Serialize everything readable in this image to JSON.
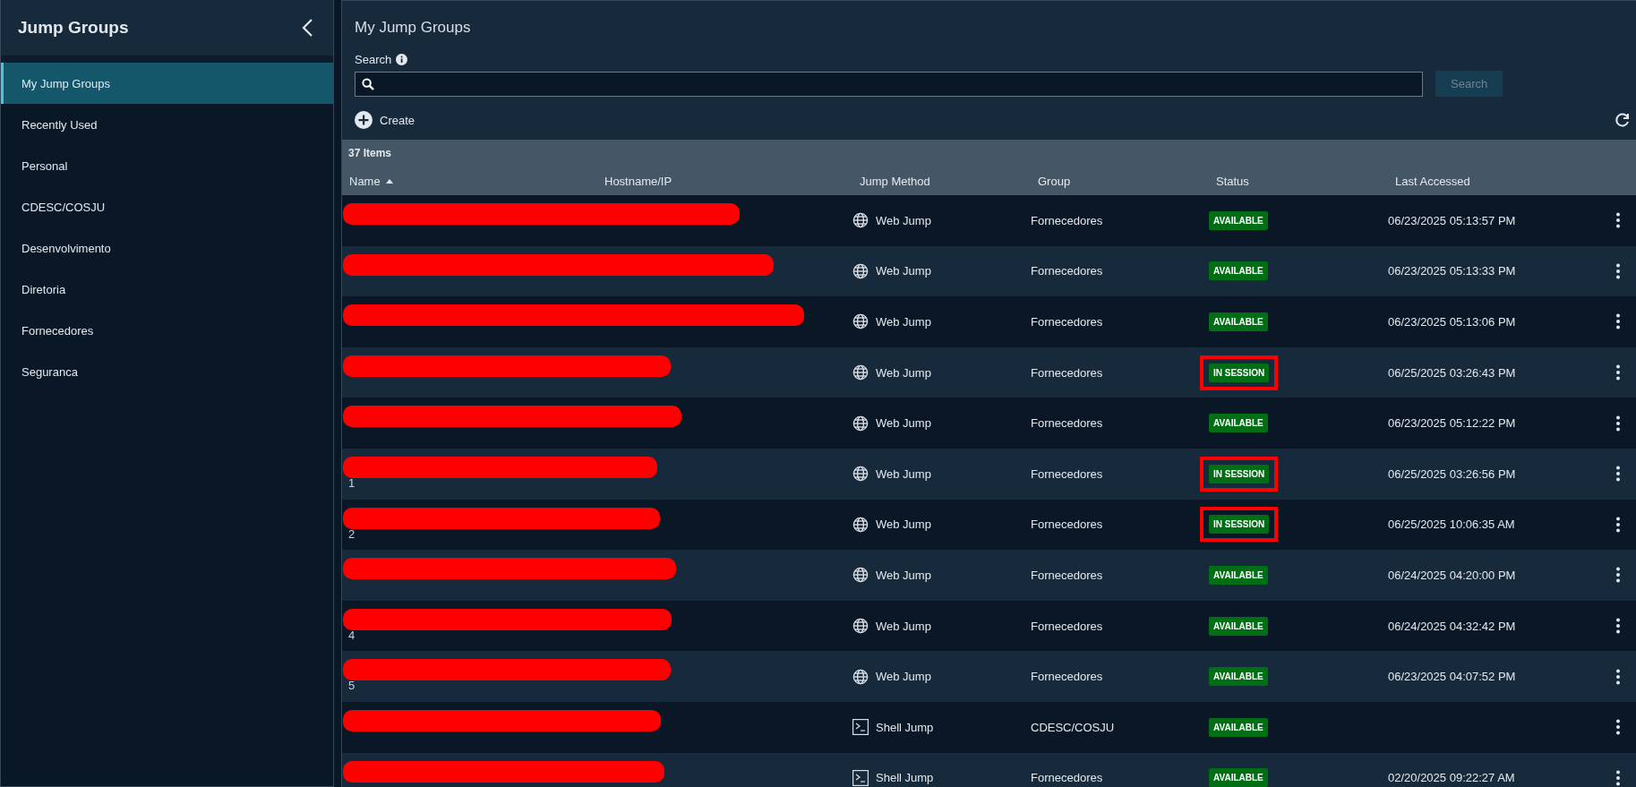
{
  "sidebar": {
    "title": "Jump Groups",
    "items": [
      {
        "label": "My Jump Groups",
        "selected": true
      },
      {
        "label": "Recently Used",
        "selected": false
      },
      {
        "label": "Personal",
        "selected": false
      },
      {
        "label": "CDESC/COSJU",
        "selected": false
      },
      {
        "label": "Desenvolvimento",
        "selected": false
      },
      {
        "label": "Diretoria",
        "selected": false
      },
      {
        "label": "Fornecedores",
        "selected": false
      },
      {
        "label": "Seguranca",
        "selected": false
      }
    ]
  },
  "main": {
    "title": "My Jump Groups",
    "search": {
      "label": "Search",
      "button": "Search"
    },
    "create": "Create"
  },
  "table": {
    "count": "37 Items",
    "columns": [
      {
        "label": "Name",
        "sorted": true
      },
      {
        "label": "Hostname/IP",
        "sorted": false
      },
      {
        "label": "Jump Method",
        "sorted": false
      },
      {
        "label": "Group",
        "sorted": false
      },
      {
        "label": "Status",
        "sorted": false
      },
      {
        "label": "Last Accessed",
        "sorted": false
      }
    ],
    "rows": [
      {
        "redacted": true,
        "method": "Web Jump",
        "kind": "web",
        "group": "Fornecedores",
        "status": "AVAILABLE",
        "highlighted": false,
        "last_accessed": "06/23/2025 05:13:57 PM"
      },
      {
        "redacted": true,
        "method": "Web Jump",
        "kind": "web",
        "group": "Fornecedores",
        "status": "AVAILABLE",
        "highlighted": false,
        "last_accessed": "06/23/2025 05:13:33 PM"
      },
      {
        "redacted": true,
        "method": "Web Jump",
        "kind": "web",
        "group": "Fornecedores",
        "status": "AVAILABLE",
        "highlighted": false,
        "last_accessed": "06/23/2025 05:13:06 PM"
      },
      {
        "redacted": true,
        "method": "Web Jump",
        "kind": "web",
        "group": "Fornecedores",
        "status": "IN SESSION",
        "highlighted": true,
        "last_accessed": "06/25/2025 03:26:43 PM"
      },
      {
        "redacted": true,
        "method": "Web Jump",
        "kind": "web",
        "group": "Fornecedores",
        "status": "AVAILABLE",
        "highlighted": false,
        "last_accessed": "06/23/2025 05:12:22 PM"
      },
      {
        "redacted": true,
        "name": "1",
        "method": "Web Jump",
        "kind": "web",
        "group": "Fornecedores",
        "status": "IN SESSION",
        "highlighted": true,
        "last_accessed": "06/25/2025 03:26:56 PM"
      },
      {
        "redacted": true,
        "name": "2",
        "method": "Web Jump",
        "kind": "web",
        "group": "Fornecedores",
        "status": "IN SESSION",
        "highlighted": true,
        "last_accessed": "06/25/2025 10:06:35 AM"
      },
      {
        "redacted": true,
        "method": "Web Jump",
        "kind": "web",
        "group": "Fornecedores",
        "status": "AVAILABLE",
        "highlighted": false,
        "last_accessed": "06/24/2025 04:20:00 PM"
      },
      {
        "redacted": true,
        "name": "4",
        "method": "Web Jump",
        "kind": "web",
        "group": "Fornecedores",
        "status": "AVAILABLE",
        "highlighted": false,
        "last_accessed": "06/24/2025 04:32:42 PM"
      },
      {
        "redacted": true,
        "name": "5",
        "method": "Web Jump",
        "kind": "web",
        "group": "Fornecedores",
        "status": "AVAILABLE",
        "highlighted": false,
        "last_accessed": "06/23/2025 04:07:52 PM"
      },
      {
        "redacted": true,
        "method": "Shell Jump",
        "kind": "shell",
        "group": "CDESC/COSJU",
        "status": "AVAILABLE",
        "highlighted": false
      },
      {
        "redacted": true,
        "method": "Shell Jump",
        "kind": "shell",
        "group": "Fornecedores",
        "status": "AVAILABLE",
        "highlighted": false,
        "last_accessed": "02/20/2025 09:22:27 AM"
      }
    ]
  }
}
